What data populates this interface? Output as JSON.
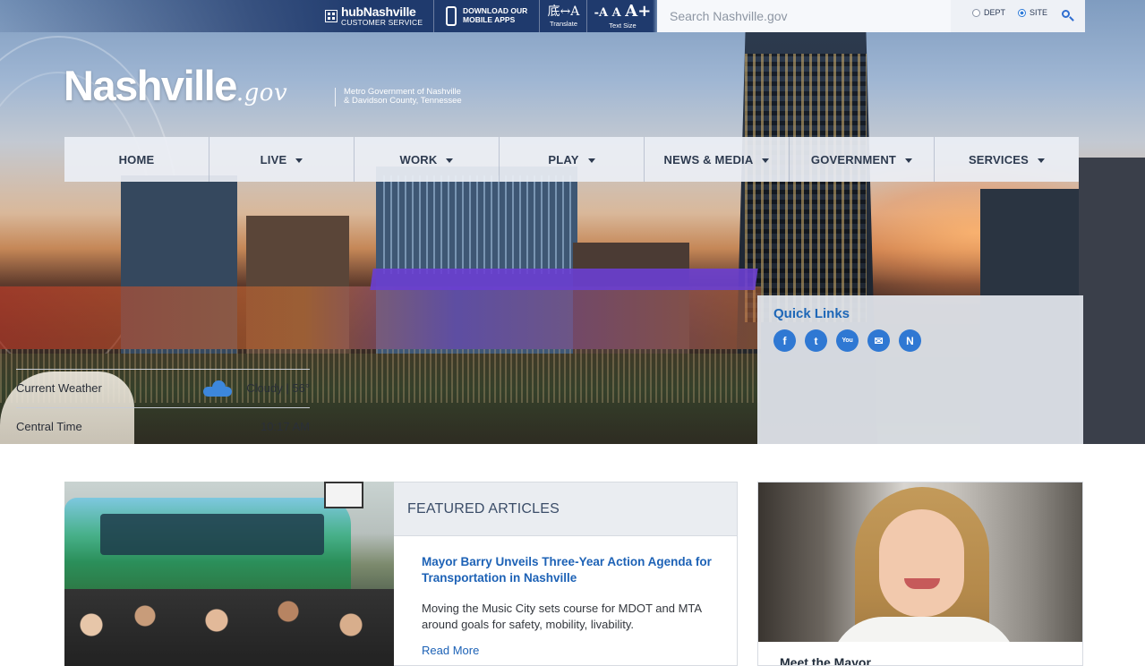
{
  "utility": {
    "hub_name": "hubNashville",
    "hub_sub": "CUSTOMER SERVICE",
    "apps_line1": "DOWNLOAD OUR",
    "apps_line2": "MOBILE APPS",
    "translate_glyph": "底↔A",
    "translate_label": "Translate",
    "size_glyph_small": "-A",
    "size_glyph_mid": "A",
    "size_glyph_big": "A+",
    "size_label": "Text Size"
  },
  "search": {
    "placeholder": "Search Nashville.gov",
    "value": "",
    "scope_dept": "DEPT",
    "scope_site": "SITE",
    "selected_scope": "SITE"
  },
  "logo": {
    "name": "Nashville",
    "suffix": ".gov",
    "tagline_1": "Metro Government of Nashville",
    "tagline_2": "& Davidson County, Tennessee"
  },
  "nav": [
    {
      "label": "HOME",
      "dropdown": false
    },
    {
      "label": "LIVE",
      "dropdown": true
    },
    {
      "label": "WORK",
      "dropdown": true
    },
    {
      "label": "PLAY",
      "dropdown": true
    },
    {
      "label": "NEWS & MEDIA",
      "dropdown": true
    },
    {
      "label": "GOVERNMENT",
      "dropdown": true
    },
    {
      "label": "SERVICES",
      "dropdown": true
    }
  ],
  "quick_links": {
    "title": "Quick Links",
    "icons": [
      "facebook-icon",
      "twitter-icon",
      "youtube-icon",
      "email-icon",
      "nashville-n-icon"
    ],
    "icon_glyphs": {
      "facebook": "f",
      "twitter": "t",
      "youtube": "You",
      "email": "✉",
      "nashville": "N"
    },
    "weather_label": "Current Weather",
    "weather_value": "Cloudy | 56°",
    "time_label": "Central Time",
    "time_value": "10:17 AM"
  },
  "featured": {
    "heading": "FEATURED ARTICLES",
    "title": "Mayor Barry Unveils Three-Year Action Agenda for Transportation in Nashville",
    "body": "Moving the Music City sets course for MDOT and MTA around goals for safety, mobility, livability.",
    "read_more": "Read More"
  },
  "mayor": {
    "caption": "Meet the Mayor"
  },
  "colors": {
    "brand_blue": "#1f3a6d",
    "link_blue": "#1d62b6",
    "icon_blue": "#2f78d3"
  }
}
